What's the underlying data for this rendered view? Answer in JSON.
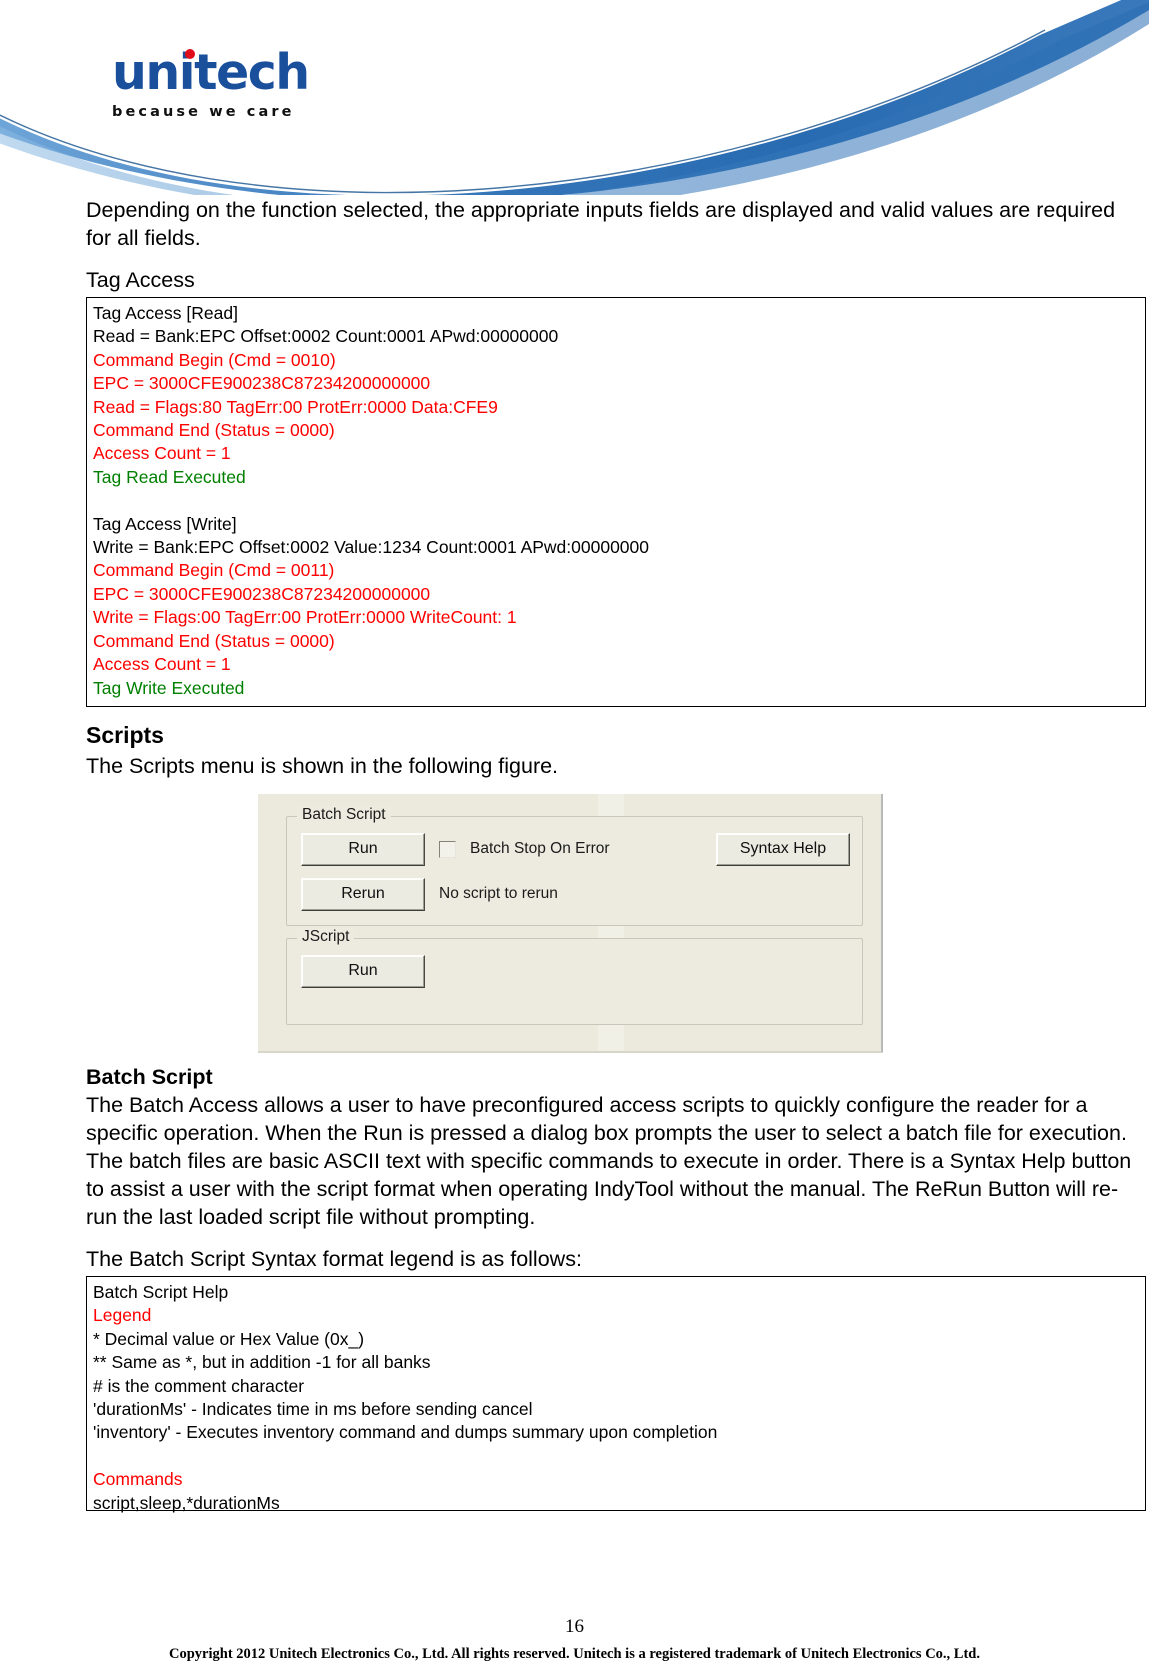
{
  "header": {
    "logo_word": "unitech",
    "logo_tagline": "because we care"
  },
  "intro_paragraph": "Depending on the function selected, the appropriate inputs fields are displayed and valid values are required for all fields.",
  "tag_access": {
    "label": "Tag Access",
    "lines": [
      {
        "text": "Tag Access [Read]",
        "color": "black"
      },
      {
        "text": "Read = Bank:EPC Offset:0002 Count:0001 APwd:00000000",
        "color": "black"
      },
      {
        "text": "Command Begin (Cmd = 0010)",
        "color": "red"
      },
      {
        "text": "EPC = 3000CFE900238C87234200000000",
        "color": "red"
      },
      {
        "text": "Read = Flags:80 TagErr:00 ProtErr:0000 Data:CFE9",
        "color": "red"
      },
      {
        "text": "Command End (Status = 0000)",
        "color": "red"
      },
      {
        "text": "Access Count = 1",
        "color": "red"
      },
      {
        "text": "Tag Read Executed",
        "color": "green"
      },
      {
        "text": " ",
        "color": "blank"
      },
      {
        "text": "Tag Access [Write]",
        "color": "black"
      },
      {
        "text": "Write = Bank:EPC Offset:0002 Value:1234 Count:0001 APwd:00000000",
        "color": "black"
      },
      {
        "text": "Command Begin (Cmd = 0011)",
        "color": "red"
      },
      {
        "text": "EPC = 3000CFE900238C87234200000000",
        "color": "red"
      },
      {
        "text": "Write = Flags:00 TagErr:00 ProtErr:0000 WriteCount: 1",
        "color": "red"
      },
      {
        "text": "Command End (Status = 0000)",
        "color": "red"
      },
      {
        "text": "Access Count = 1",
        "color": "red"
      },
      {
        "text": "Tag Write Executed",
        "color": "green"
      }
    ]
  },
  "scripts": {
    "heading": "Scripts",
    "intro": "The Scripts menu is shown in the following figure.",
    "dialog": {
      "batch_group_legend": "Batch Script",
      "run_button": "Run",
      "rerun_button": "Rerun",
      "stop_on_error_label": "Batch Stop On Error",
      "stop_on_error_checked": false,
      "syntax_help_button": "Syntax Help",
      "rerun_status": "No script to rerun",
      "jscript_group_legend": "JScript",
      "jscript_run_button": "Run"
    }
  },
  "batch_script": {
    "heading": "Batch Script",
    "paragraph": "The Batch Access allows a user to have preconfigured access scripts to quickly configure the reader for a specific operation. When the Run is pressed a dialog box prompts the user to select a batch file for execution. The batch files are basic ASCII text with specific commands to execute in order. There is a Syntax Help button to assist a user with the script format when operating IndyTool without the manual. The ReRun Button will re-run the last loaded script file without prompting.",
    "legend_intro": "The Batch Script Syntax format legend is as follows:",
    "help_lines": [
      {
        "text": "Batch Script Help",
        "color": "black"
      },
      {
        "text": "Legend",
        "color": "red"
      },
      {
        "text": "* Decimal value or Hex Value (0x_)",
        "color": "black"
      },
      {
        "text": "** Same as *, but in addition -1 for all banks",
        "color": "black"
      },
      {
        "text": "# is the comment character",
        "color": "black"
      },
      {
        "text": "'durationMs' - Indicates time in ms before sending cancel",
        "color": "black"
      },
      {
        "text": "'inventory' - Executes inventory command and dumps summary upon completion",
        "color": "black"
      },
      {
        "text": " ",
        "color": "blank"
      },
      {
        "text": "Commands",
        "color": "red"
      },
      {
        "text": "script,sleep,*durationMs",
        "color": "black"
      }
    ]
  },
  "footer": {
    "page_number": "16",
    "copyright": "Copyright 2012 Unitech Electronics Co., Ltd. All rights reserved. Unitech is a registered trademark of Unitech Electronics Co., Ltd."
  },
  "colors": {
    "brand_blue": "#1a4f9c",
    "swoosh_blue": "#2f72b8",
    "accent_red": "#e00b1b",
    "console_red": "#ff0000",
    "console_green": "#008000"
  }
}
